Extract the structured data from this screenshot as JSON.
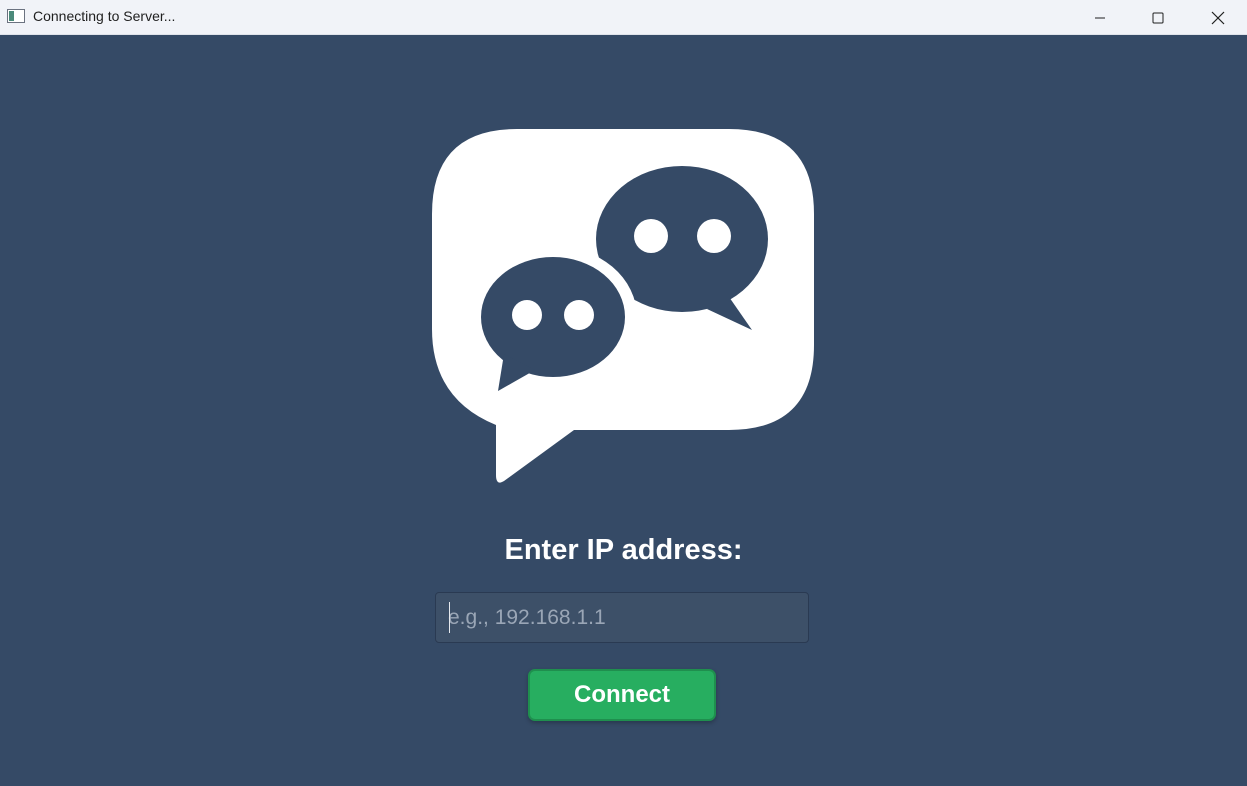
{
  "window": {
    "title": "Connecting to Server...",
    "app_icon": "window-icon",
    "controls": {
      "minimize": "minimize-icon",
      "maximize": "maximize-icon",
      "close": "close-icon"
    }
  },
  "main": {
    "logo_icon": "chat-bubbles-icon",
    "prompt_label": "Enter IP address:",
    "ip_input": {
      "value": "",
      "placeholder": "e.g., 192.168.1.1"
    },
    "connect_label": "Connect"
  },
  "colors": {
    "background": "#354a66",
    "titlebar": "#f1f3f8",
    "input_bg": "#3d5068",
    "button": "#27ae60",
    "logo": "#ffffff"
  }
}
